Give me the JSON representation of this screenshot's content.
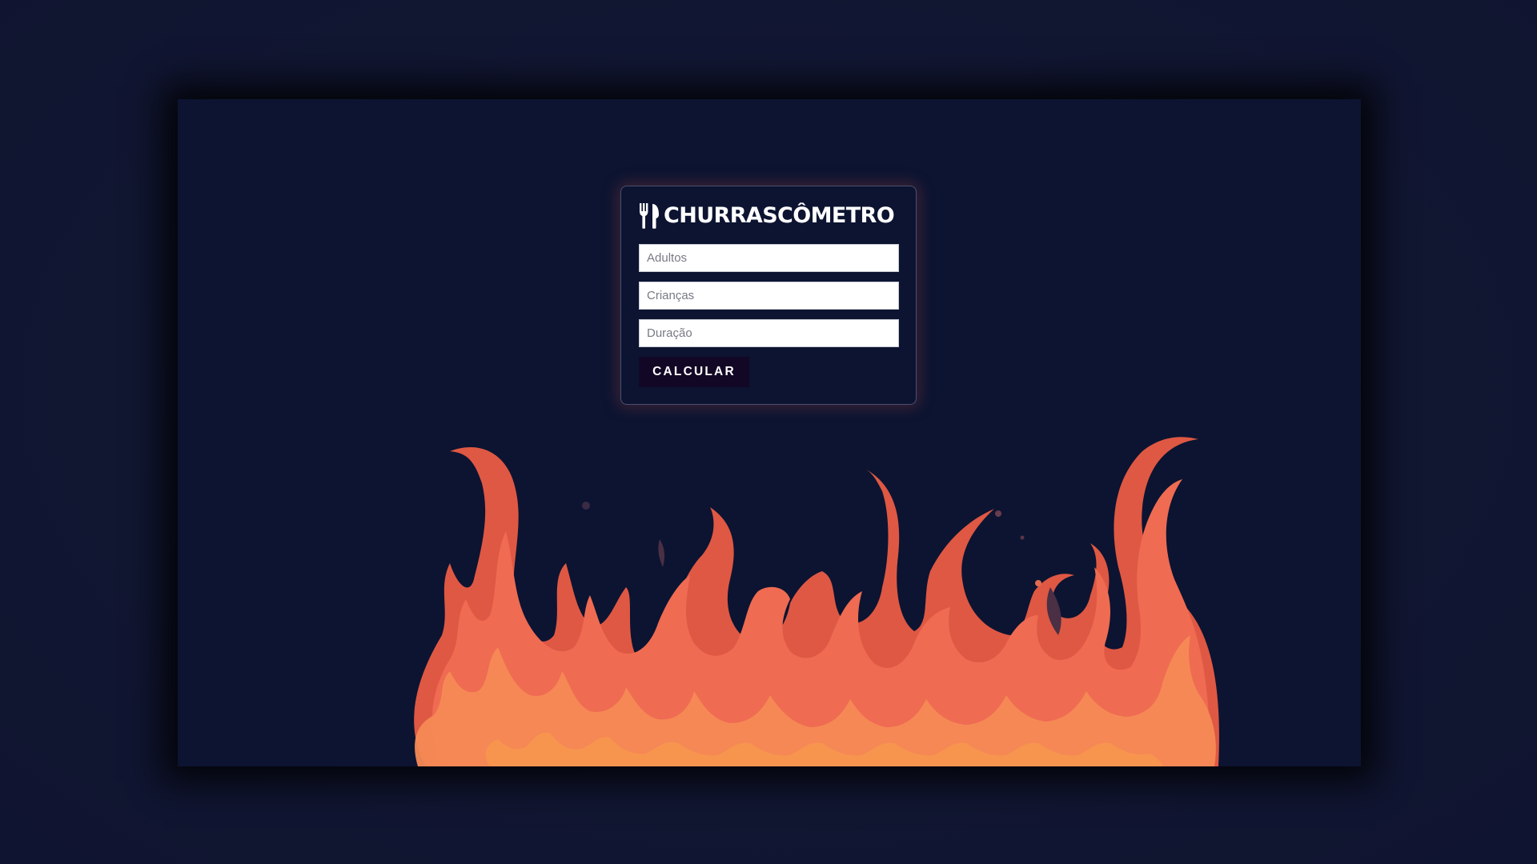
{
  "app": {
    "title": "CHURRASCÔMETRO",
    "title_icon": "fork-knife-icon"
  },
  "form": {
    "adults_placeholder": "Adultos",
    "children_placeholder": "Crianças",
    "duration_placeholder": "Duração",
    "adults_value": "",
    "children_value": "",
    "duration_value": "",
    "submit_label": "CALCULAR"
  },
  "decoration": {
    "background": "fire-flames-illustration"
  },
  "colors": {
    "page_background": "#111631",
    "frame_background": "#0c1431",
    "button_background": "#130726",
    "flame_dark": "#e05a45",
    "flame_mid": "#ef6b52",
    "flame_light": "#f58a55"
  }
}
